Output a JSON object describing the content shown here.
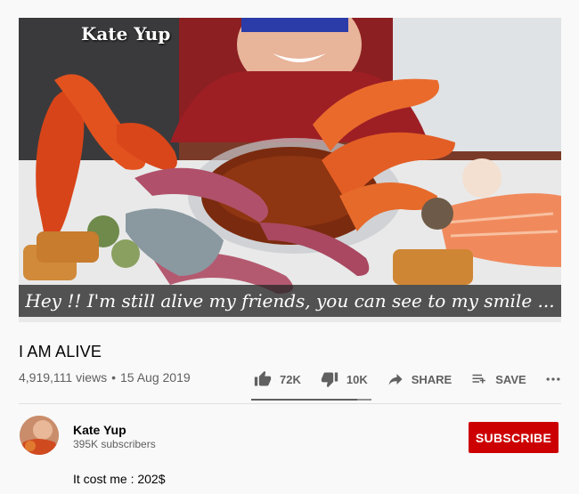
{
  "video": {
    "watermark": "Kate Yup",
    "caption": "Hey !! I'm still alive my friends, you can see to my smile ..."
  },
  "title": "I AM ALIVE",
  "meta": {
    "views": "4,919,111 views",
    "separator": "•",
    "date": "15 Aug 2019"
  },
  "actions": {
    "like_label": "72K",
    "dislike_label": "10K",
    "share_label": "SHARE",
    "save_label": "SAVE",
    "like_ratio": 0.88
  },
  "channel": {
    "name": "Kate Yup",
    "subscribers": "395K subscribers"
  },
  "subscribe_label": "SUBSCRIBE",
  "description": "It cost me : 202$",
  "colors": {
    "subscribe_bg": "#cc0000",
    "text_secondary": "#606060",
    "background": "#f9f9f9"
  },
  "icons": [
    "thumbs-up-icon",
    "thumbs-down-icon",
    "share-icon",
    "save-playlist-icon",
    "more-icon"
  ]
}
